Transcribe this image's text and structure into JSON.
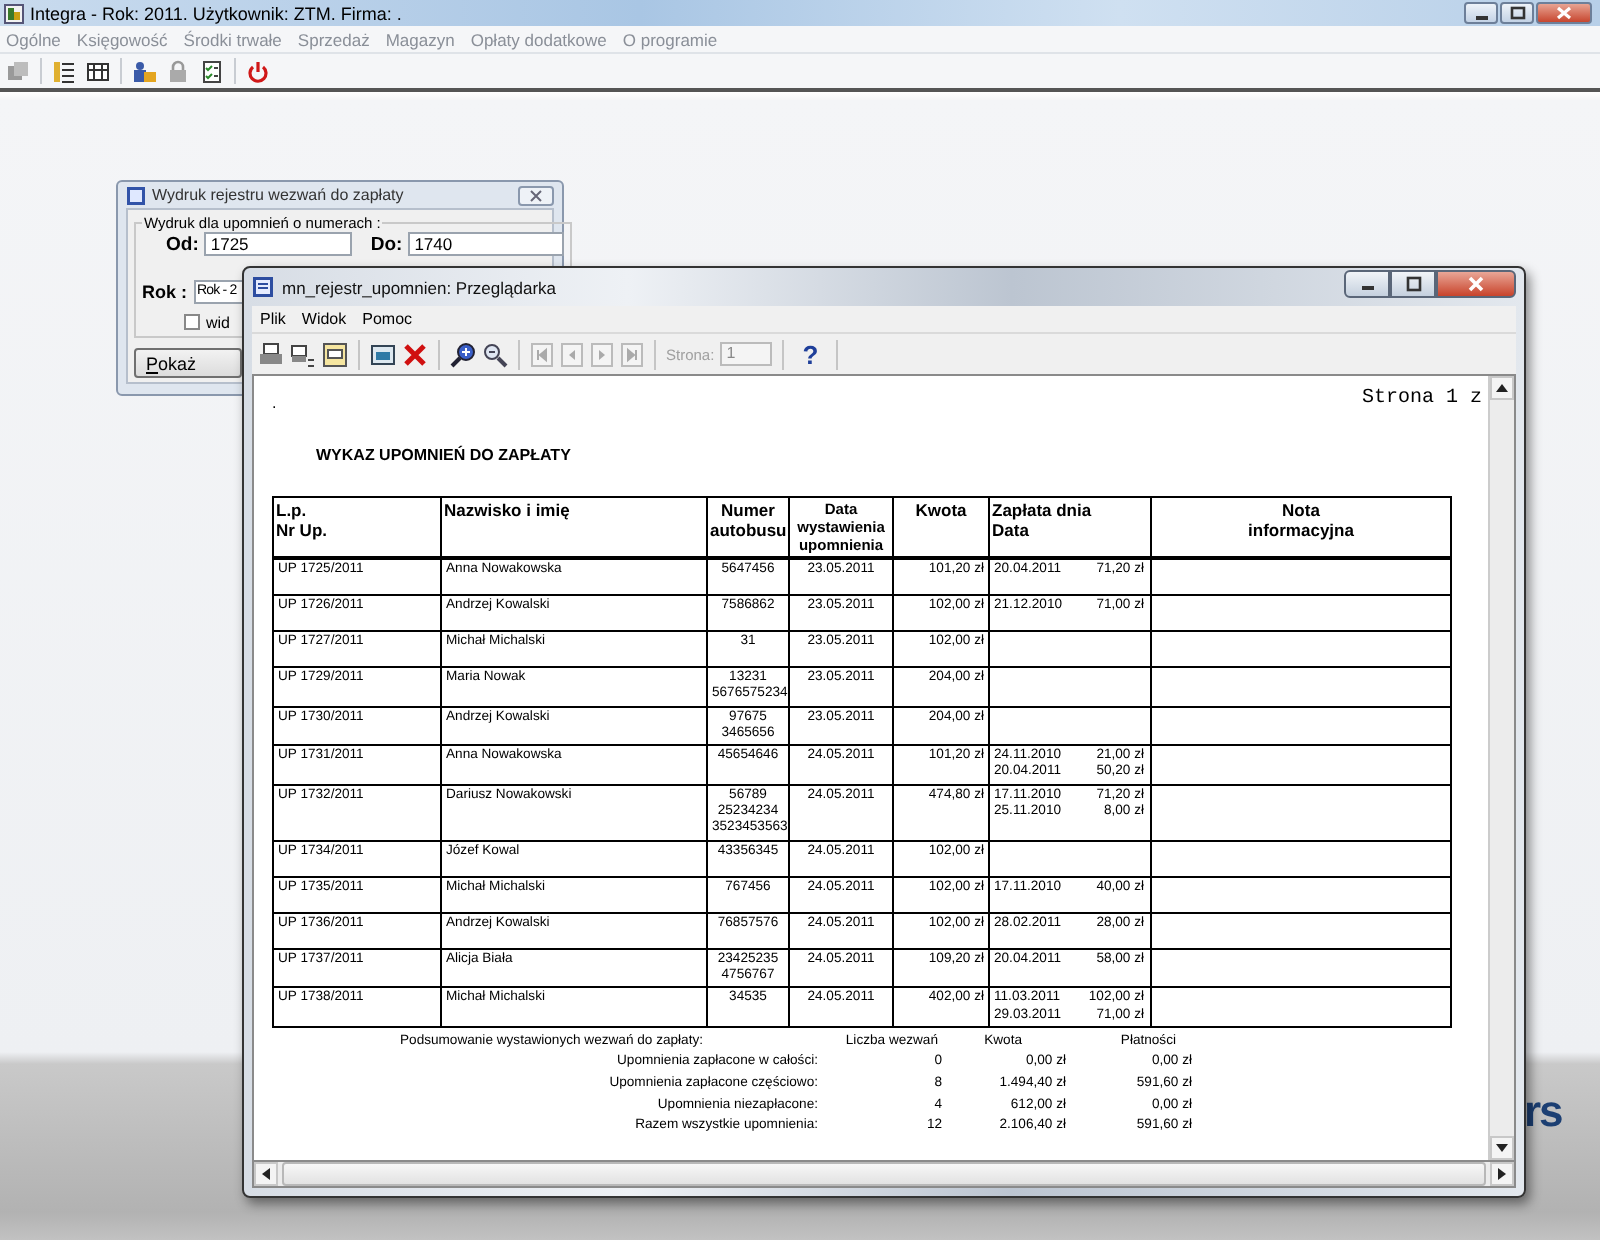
{
  "window": {
    "title": "Integra -  Rok: 2011. Użytkownik: ZTM. Firma: ."
  },
  "menu": [
    "Ogólne",
    "Księgowość",
    "Środki trwałe",
    "Sprzedaż",
    "Magazyn",
    "Opłaty dodatkowe",
    "O programie"
  ],
  "background_logo": "rs",
  "dialog": {
    "title": "Wydruk rejestru wezwań do zapłaty",
    "group": "Wydruk dla upomnień o numerach :",
    "fields": [
      {
        "label": "Od:",
        "value": "1725"
      },
      {
        "label": "Do:",
        "value": "1740"
      }
    ],
    "year": {
      "label": "Rok :",
      "value": "Rok - 2"
    },
    "checkbox": {
      "label": "wid",
      "checked": false
    },
    "button": "Pokaż"
  },
  "viewer": {
    "title": "mn_rejestr_upomnien: Przeglądarka",
    "menu": [
      "Plik",
      "Widok",
      "Pomoc"
    ],
    "page_label": "Strona:",
    "page_value": "1",
    "help": "?",
    "page_counter": "Strona 1 z",
    "dot": ".",
    "report_title": "WYKAZ UPOMNIEŃ DO ZAPŁATY",
    "table": {
      "columns": [
        "L.p.\nNr Up.",
        "Nazwisko i imię",
        "Numer\nautobusu",
        "Data\nwystawienia\nupomnienia",
        "Kwota",
        "Zapłata dnia\nData",
        "Nota\ninformacyjna"
      ],
      "rows": [
        {
          "number": "UP 1725/2011",
          "name": "Anna Nowakowska",
          "bus": "5647456",
          "date": "23.05.2011",
          "amount": "101,20 zł",
          "payments": [
            {
              "date": "20.04.2011",
              "amount": "71,20 zł"
            }
          ]
        },
        {
          "number": "UP 1726/2011",
          "name": "Andrzej Kowalski",
          "bus": "7586862",
          "date": "23.05.2011",
          "amount": "102,00 zł",
          "payments": [
            {
              "date": "21.12.2010",
              "amount": "71,00 zł"
            }
          ]
        },
        {
          "number": "UP 1727/2011",
          "name": "Michał Michalski",
          "bus": "31",
          "date": "23.05.2011",
          "amount": "102,00 zł",
          "payments": []
        },
        {
          "number": "UP 1729/2011",
          "name": "Maria Nowak",
          "bus": "13231\n5676575234",
          "date": "23.05.2011",
          "amount": "204,00 zł",
          "payments": []
        },
        {
          "number": "UP 1730/2011",
          "name": "Andrzej Kowalski",
          "bus": "97675\n3465656",
          "date": "23.05.2011",
          "amount": "204,00 zł",
          "payments": []
        },
        {
          "number": "UP 1731/2011",
          "name": "Anna Nowakowska",
          "bus": "45654646",
          "date": "24.05.2011",
          "amount": "101,20 zł",
          "payments": [
            {
              "date": "24.11.2010",
              "amount": "21,00 zł"
            },
            {
              "date": "20.04.2011",
              "amount": "50,20 zł"
            }
          ]
        },
        {
          "number": "UP 1732/2011",
          "name": "Dariusz Nowakowski",
          "bus": "56789\n25234234\n3523453563",
          "date": "24.05.2011",
          "amount": "474,80 zł",
          "payments": [
            {
              "date": "17.11.2010",
              "amount": "71,20 zł"
            },
            {
              "date": "25.11.2010",
              "amount": "8,00 zł"
            }
          ]
        },
        {
          "number": "UP 1734/2011",
          "name": "Józef Kowal",
          "bus": "43356345",
          "date": "24.05.2011",
          "amount": "102,00 zł",
          "payments": []
        },
        {
          "number": "UP 1735/2011",
          "name": "Michał Michalski",
          "bus": "767456",
          "date": "24.05.2011",
          "amount": "102,00 zł",
          "payments": [
            {
              "date": "17.11.2010",
              "amount": "40,00 zł"
            }
          ]
        },
        {
          "number": "UP 1736/2011",
          "name": "Andrzej Kowalski",
          "bus": "76857576",
          "date": "24.05.2011",
          "amount": "102,00 zł",
          "payments": [
            {
              "date": "28.02.2011",
              "amount": "28,00 zł"
            }
          ]
        },
        {
          "number": "UP 1737/2011",
          "name": "Alicja Biała",
          "bus": "23425235\n4756767",
          "date": "24.05.2011",
          "amount": "109,20 zł",
          "payments": [
            {
              "date": "20.04.2011",
              "amount": "58,00 zł"
            }
          ]
        },
        {
          "number": "UP 1738/2011",
          "name": "Michał Michalski",
          "bus": "34535",
          "date": "24.05.2011",
          "amount": "402,00 zł",
          "payments": [
            {
              "date": "11.03.2011",
              "amount": "102,00 zł"
            },
            {
              "date": "29.03.2011",
              "amount": "71,00 zł"
            }
          ]
        }
      ]
    },
    "summary": {
      "title": "Podsumowanie wystawionych wezwań do zapłaty:",
      "columns": [
        "Liczba wezwań",
        "Kwota",
        "Płatności"
      ],
      "rows": [
        {
          "label": "Upomnienia zapłacone w całości:",
          "count": "0",
          "amount": "0,00 zł",
          "payments": "0,00 zł"
        },
        {
          "label": "Upomnienia zapłacone częściowo:",
          "count": "8",
          "amount": "1.494,40 zł",
          "payments": "591,60 zł"
        },
        {
          "label": "Upomnienia niezapłacone:",
          "count": "4",
          "amount": "612,00 zł",
          "payments": "0,00 zł"
        },
        {
          "label": "Razem wszystkie upomnienia:",
          "count": "12",
          "amount": "2.106,40 zł",
          "payments": "591,60 zł"
        }
      ]
    }
  }
}
